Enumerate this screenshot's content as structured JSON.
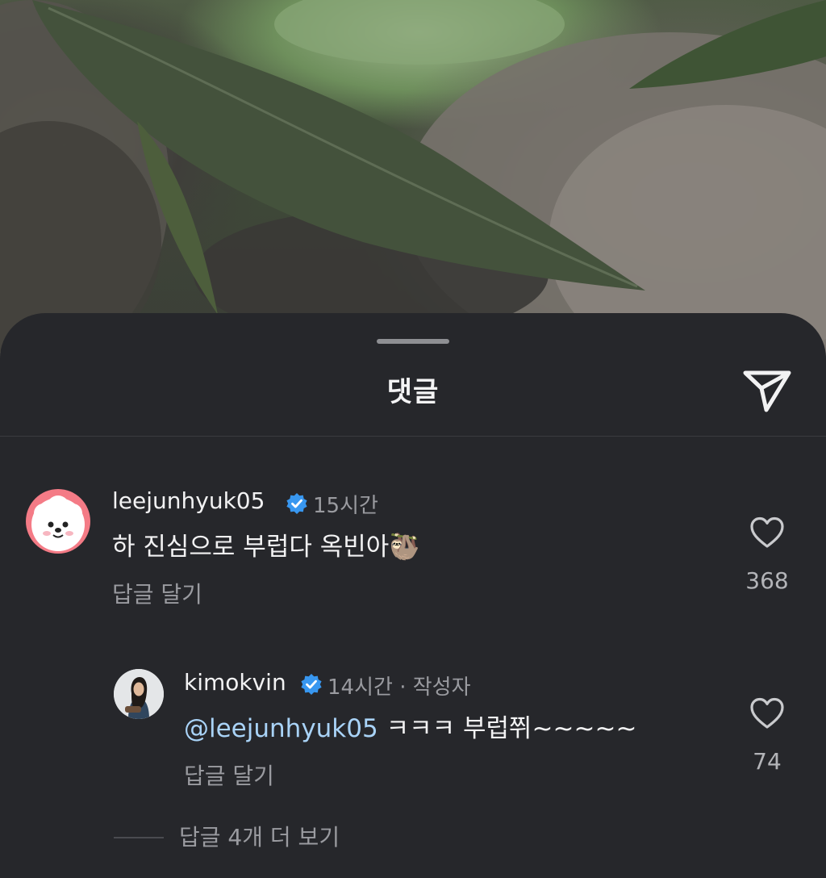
{
  "header": {
    "title": "댓글",
    "send_icon": "paper-plane-icon"
  },
  "comments": [
    {
      "username": "leejunhyuk05",
      "verified": true,
      "time": "15시간",
      "text": "하 진심으로 부럽다 옥빈아",
      "emoji": "🦥",
      "reply_label": "답글 달기",
      "likes": "368",
      "avatar_icon": "puppy-cartoon-avatar"
    }
  ],
  "reply": {
    "username": "kimokvin",
    "verified": true,
    "time": "14시간",
    "separator": "·",
    "badge": "작성자",
    "mention": "@leejunhyuk05",
    "text": "ㅋㅋㅋ 부럽쮜~~~~~",
    "reply_label": "답글 달기",
    "likes": "74",
    "avatar_icon": "user-photo-avatar"
  },
  "more_replies": "답글 4개 더 보기",
  "colors": {
    "sheet_bg": "#26272b",
    "verified_blue": "#3897f0",
    "mention": "#a9d3f7",
    "muted_text": "#9a9ba0"
  }
}
